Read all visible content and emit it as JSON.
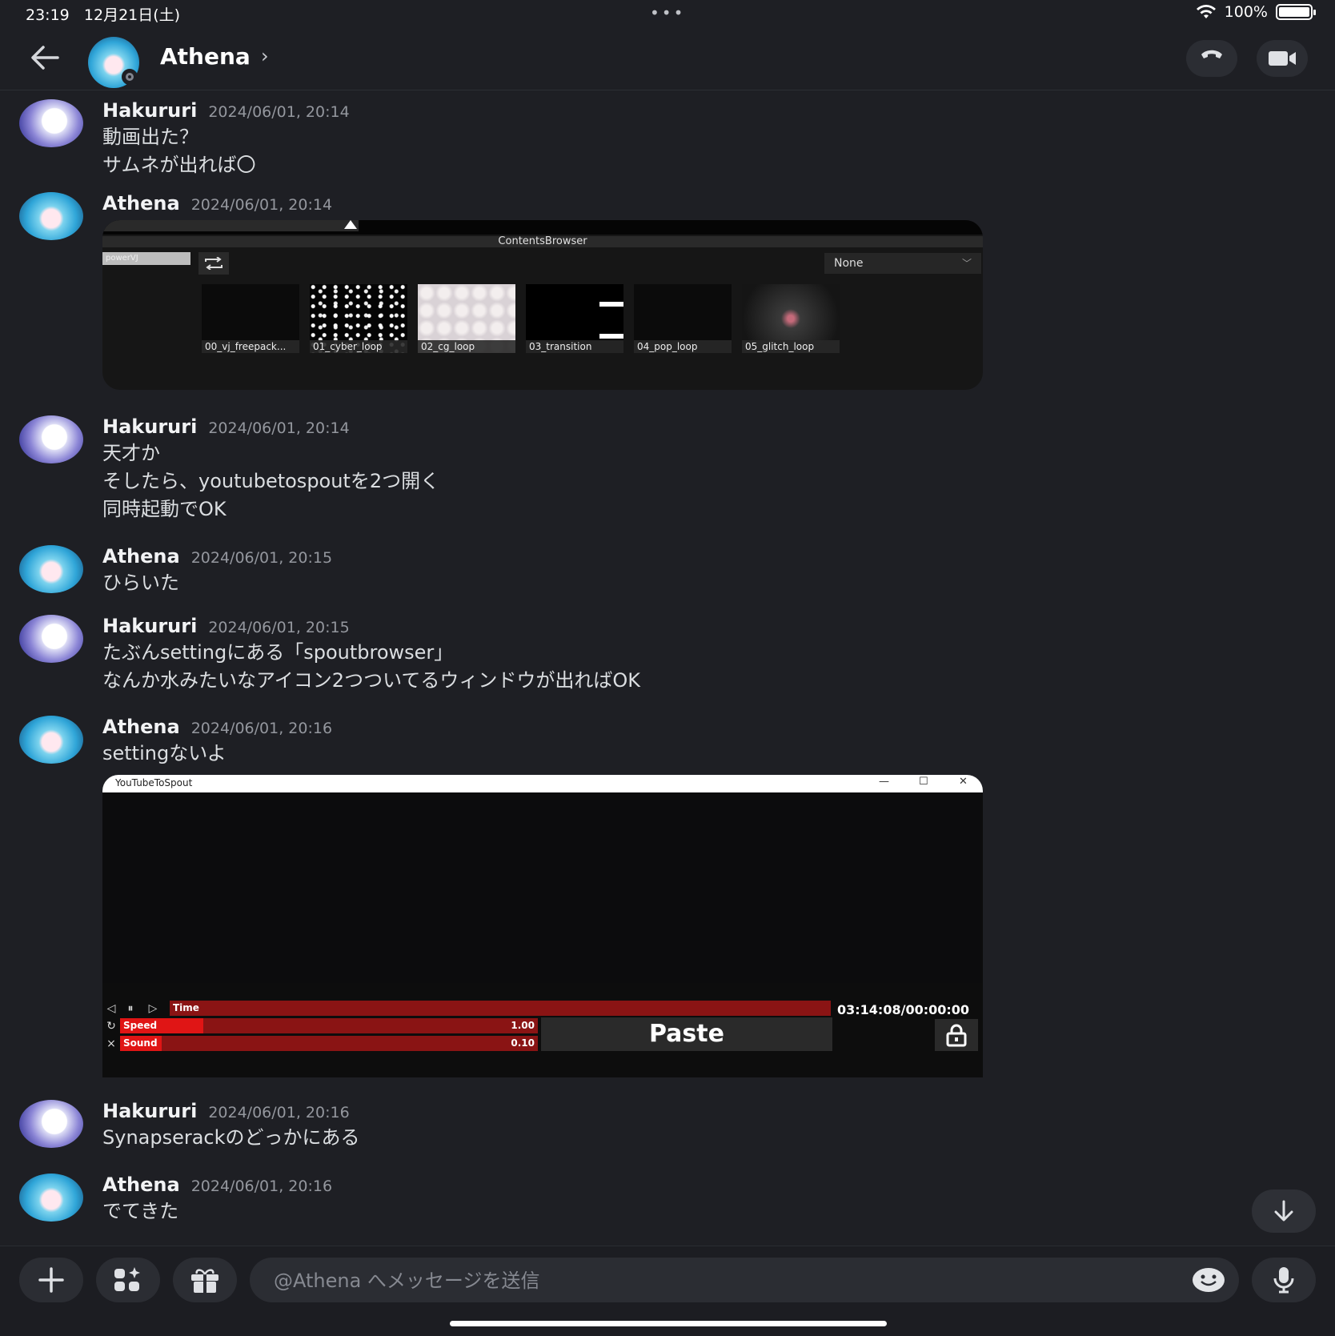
{
  "status": {
    "time": "23:19",
    "date": "12月21日(土)",
    "battery": "100%"
  },
  "header": {
    "name": "Athena",
    "chevron": "›"
  },
  "messages": [
    {
      "author": "Hakururi",
      "time": "2024/06/01, 20:14",
      "lines": [
        "動画出た？",
        "サムネが出れば〇"
      ]
    },
    {
      "author": "Athena",
      "time": "2024/06/01, 20:14",
      "lines": []
    },
    {
      "author": "Hakururi",
      "time": "2024/06/01, 20:14",
      "lines": [
        "天才か",
        "そしたら、youtubetospoutを2つ開く",
        "同時起動でOK"
      ]
    },
    {
      "author": "Athena",
      "time": "2024/06/01, 20:15",
      "lines": [
        "ひらいた"
      ]
    },
    {
      "author": "Hakururi",
      "time": "2024/06/01, 20:15",
      "lines": [
        "たぶんsettingにある「spoutbrowser」",
        "なんか水みたいなアイコン2つついてるウィンドウが出ればOK"
      ]
    },
    {
      "author": "Athena",
      "time": "2024/06/01, 20:16",
      "lines": [
        "settingないよ"
      ]
    },
    {
      "author": "Hakururi",
      "time": "2024/06/01, 20:16",
      "lines": [
        "Synapserackのどっかにある"
      ]
    },
    {
      "author": "Athena",
      "time": "2024/06/01, 20:16",
      "lines": [
        "でてきた"
      ]
    }
  ],
  "attachment_contents_browser": {
    "window_title": "ContentsBrowser",
    "source_field": "powerVJ",
    "dropdown_value": "None",
    "thumbnails": [
      "00_vj_freepack...",
      "01_cyber_loop",
      "02_cg_loop",
      "03_transition",
      "04_pop_loop",
      "05_glitch_loop"
    ]
  },
  "attachment_youtube_to_spout": {
    "window_title": "YouTubeToSpout",
    "time_label": "Time",
    "timecode": "03:14:08/00:00:00",
    "speed_label": "Speed",
    "speed_value": "1.00",
    "speed_level": 0.2,
    "sound_label": "Sound",
    "sound_value": "0.10",
    "sound_level": 0.1,
    "paste_label": "Paste"
  },
  "composer": {
    "placeholder": "@Athena へメッセージを送信"
  },
  "icons": [
    "back-arrow-icon",
    "phone-icon",
    "video-camera-icon",
    "plus-icon",
    "apps-icon",
    "gift-icon",
    "emoji-icon",
    "microphone-icon",
    "arrow-down-icon",
    "wifi-icon",
    "battery-icon",
    "lock-icon",
    "loop-icon"
  ]
}
